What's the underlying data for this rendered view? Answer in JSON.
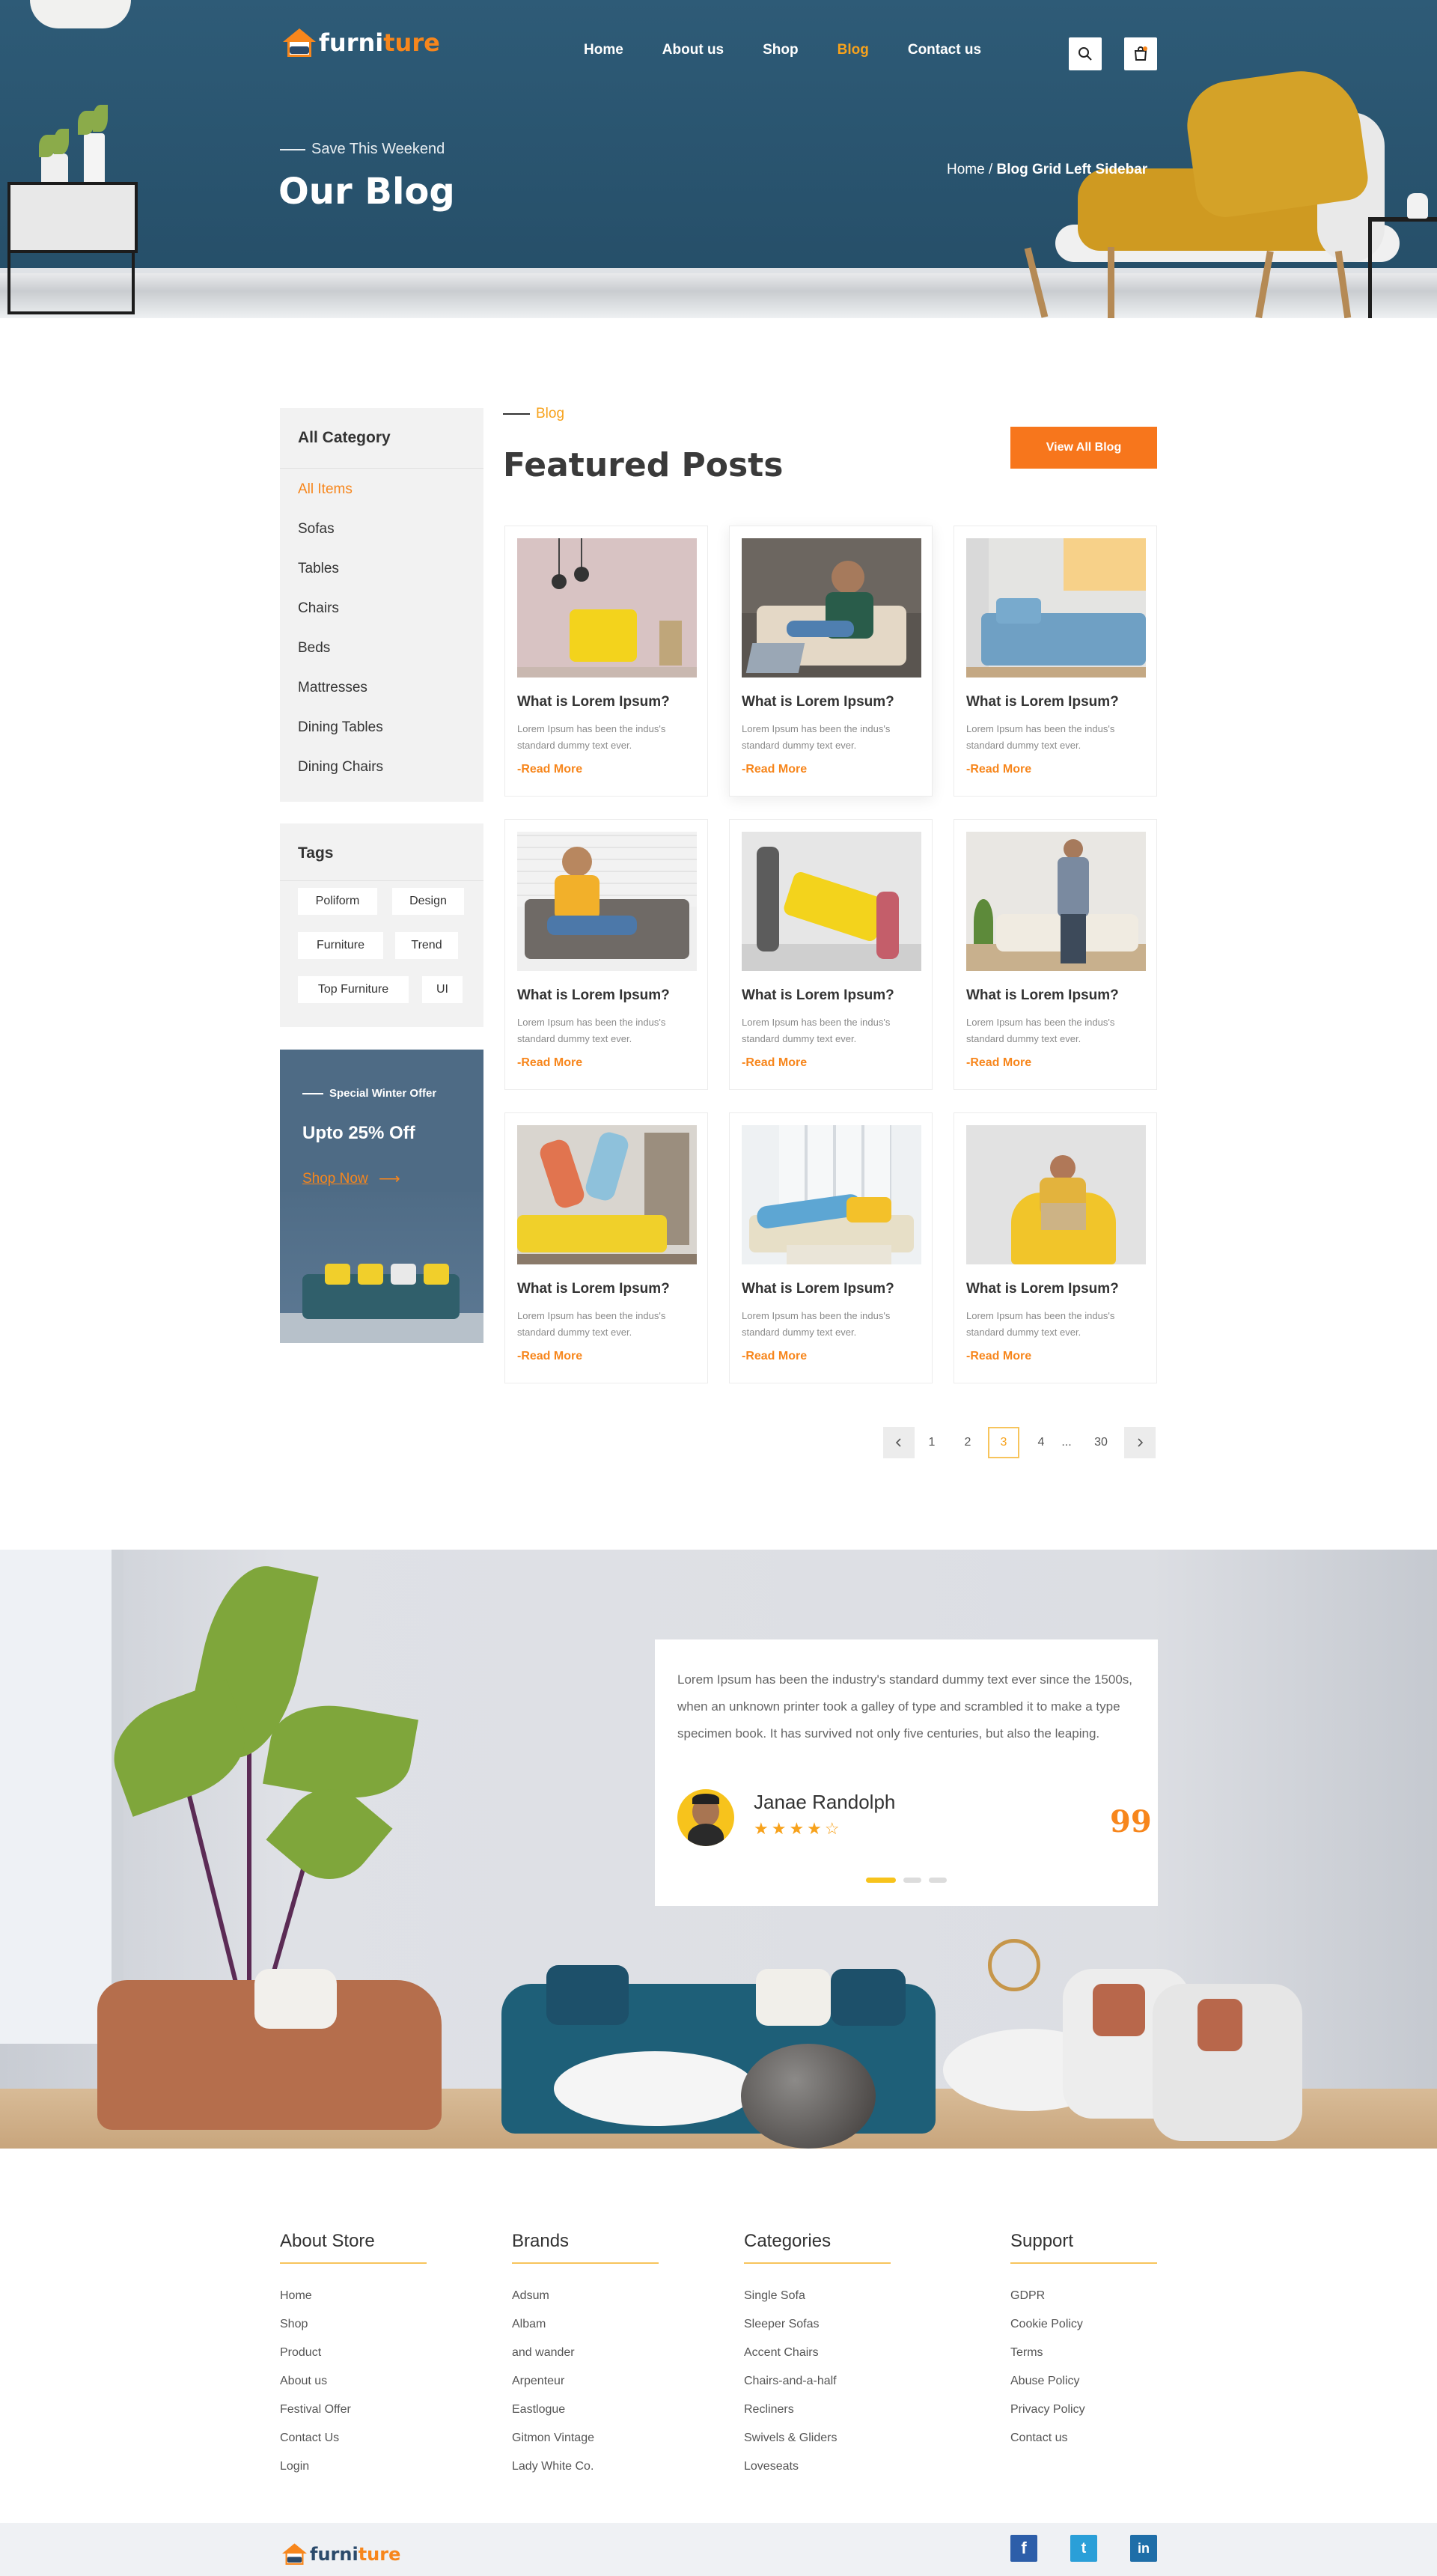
{
  "brand": {
    "part1": "furni",
    "part2": "ture"
  },
  "nav": {
    "items": [
      "Home",
      "About us",
      "Shop",
      "Blog",
      "Contact us"
    ],
    "active": "Blog"
  },
  "hero": {
    "kicker": "Save This Weekend",
    "title": "Our Blog",
    "breadcrumb_home": "Home /",
    "breadcrumb_current": "Blog Grid Left Sidebar"
  },
  "sidebar": {
    "category_title": "All Category",
    "categories": [
      "All Items",
      "Sofas",
      "Tables",
      "Chairs",
      "Beds",
      "Mattresses",
      "Dining Tables",
      "Dining Chairs"
    ],
    "tags_title": "Tags",
    "tags": [
      "Poliform",
      "Design",
      "Furniture",
      "Trend",
      "Top Furniture",
      "UI"
    ],
    "promo": {
      "kicker": "Special Winter Offer",
      "title": "Upto 25% Off",
      "link": "Shop Now"
    }
  },
  "posts_section": {
    "kicker": "Blog",
    "title": "Featured Posts",
    "button": "View All Blog",
    "posts": [
      {
        "title": "What is Lorem Ipsum?",
        "desc": "Lorem Ipsum has been the indus's standard dummy text ever.",
        "more": "-Read More"
      },
      {
        "title": "What is Lorem Ipsum?",
        "desc": "Lorem Ipsum has been the indus's standard dummy text ever.",
        "more": "-Read More"
      },
      {
        "title": "What is Lorem Ipsum?",
        "desc": "Lorem Ipsum has been the indus's standard dummy text ever.",
        "more": "-Read More"
      },
      {
        "title": "What is Lorem Ipsum?",
        "desc": "Lorem Ipsum has been the indus's standard dummy text ever.",
        "more": "-Read More"
      },
      {
        "title": "What is Lorem Ipsum?",
        "desc": "Lorem Ipsum has been the indus's standard dummy text ever.",
        "more": "-Read More"
      },
      {
        "title": "What is Lorem Ipsum?",
        "desc": "Lorem Ipsum has been the indus's standard dummy text ever.",
        "more": "-Read More"
      },
      {
        "title": "What is Lorem Ipsum?",
        "desc": "Lorem Ipsum has been the indus's standard dummy text ever.",
        "more": "-Read More"
      },
      {
        "title": "What is Lorem Ipsum?",
        "desc": "Lorem Ipsum has been the indus's standard dummy text ever.",
        "more": "-Read More"
      },
      {
        "title": "What is Lorem Ipsum?",
        "desc": "Lorem Ipsum has been the indus's standard dummy text ever.",
        "more": "-Read More"
      }
    ],
    "pagination": {
      "pages": [
        "1",
        "2",
        "3",
        "4",
        "...",
        "30"
      ],
      "current": "3"
    }
  },
  "testimonial": {
    "quote": "Lorem Ipsum has been the industry's standard dummy text ever since the 1500s, when an unknown printer took a galley of type and scrambled it to make a type specimen book. It has survived not only five centuries, but also the leaping.",
    "name": "Janae Randolph",
    "rating": 4,
    "max_rating": 5,
    "stars_text": "★★★★☆",
    "quote_mark": "99"
  },
  "footer": {
    "columns": [
      {
        "title": "About Store",
        "links": [
          "Home",
          "Shop",
          "Product",
          "About us",
          "Festival Offer",
          "Contact Us",
          "Login"
        ]
      },
      {
        "title": "Brands",
        "links": [
          "Adsum",
          "Albam",
          "and wander",
          "Arpenteur",
          "Eastlogue",
          "Gitmon Vintage",
          "Lady White Co."
        ]
      },
      {
        "title": "Categories",
        "links": [
          "Single Sofa",
          "Sleeper Sofas",
          "Accent Chairs",
          "Chairs-and-a-half",
          "Recliners",
          "Swivels & Gliders",
          "Loveseats"
        ]
      },
      {
        "title": "Support",
        "links": [
          "GDPR",
          "Cookie Policy",
          "Terms",
          "Abuse Policy",
          "Privacy Policy",
          "Contact us"
        ]
      }
    ],
    "social": {
      "facebook": "f",
      "twitter": "t",
      "linkedin": "in"
    }
  },
  "colors": {
    "accent": "#f7861c",
    "hero_bg": "#2b5570",
    "star": "#f7a21c",
    "footer_bar": "#eff1f4"
  }
}
